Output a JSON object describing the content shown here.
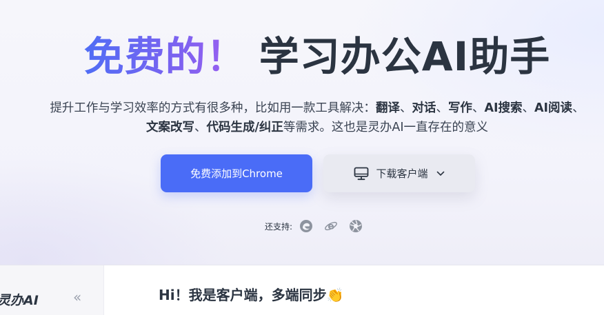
{
  "hero": {
    "headline_highlight": "免费的！",
    "headline_main": "学习办公AI助手",
    "desc": {
      "intro": "提升工作与学习效率的方式有很多种，比如用一款工具解决：",
      "b1": "翻译",
      "sep1": "、",
      "b2": "对话",
      "sep2": "、",
      "b3": "写作",
      "sep3": "、",
      "b4": "AI搜索",
      "sep4": "、",
      "b5": "AI阅读",
      "sep5": "、",
      "b6": "文案改写",
      "sep6": "、",
      "b7": "代码生成/纠正",
      "outro": "等需求。这也是灵办AI一直存在的意义"
    },
    "primary_button": "免费添加到Chrome",
    "secondary_button": "下载客户端",
    "support_label": "还支持:"
  },
  "icons": {
    "browser_1": "edge-browser-icon",
    "browser_2": "ie-browser-icon",
    "browser_3": "other-browser-icon",
    "monitor": "monitor-icon",
    "chevron": "chevron-down-icon"
  },
  "app": {
    "logo": "灵办AI",
    "collapse": "«",
    "greeting": "Hi！我是客户端，多端同步",
    "wave": "👏"
  },
  "colors": {
    "primary": "#4a6cf7",
    "text": "#2b3441"
  }
}
